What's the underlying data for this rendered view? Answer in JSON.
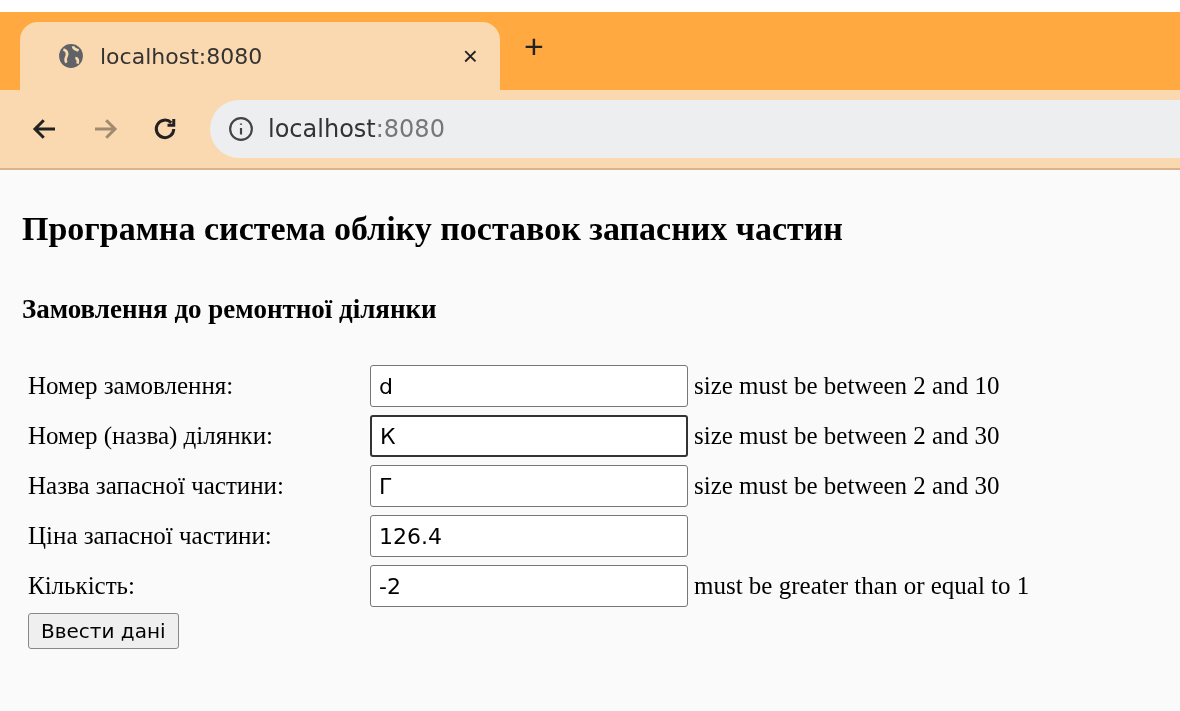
{
  "browser": {
    "tab": {
      "title": "localhost:8080",
      "close": "×",
      "new_tab": "+"
    },
    "address": {
      "host": "localhost",
      "port": ":8080"
    },
    "nav": [
      {
        "kind": "back",
        "disabled": false
      },
      {
        "kind": "forward",
        "disabled": true
      },
      {
        "kind": "reload",
        "disabled": false
      }
    ]
  },
  "page": {
    "title": "Програмна система обліку поставок запасних частин",
    "subtitle": "Замовлення до ремонтної ділянки",
    "fields": [
      {
        "label": "Номер замовлення:",
        "value": "d",
        "error": "size must be between 2 and 10",
        "focused": false
      },
      {
        "label": "Номер (назва) ділянки:",
        "value": "К",
        "error": "size must be between 2 and 30",
        "focused": true
      },
      {
        "label": "Назва запасної частини:",
        "value": "Г",
        "error": "size must be between 2 and 30",
        "focused": false
      },
      {
        "label": "Ціна запасної частини:",
        "value": "126.4",
        "focused": false
      },
      {
        "label": "Кількість:",
        "value": "-2",
        "error": "must be greater than or equal to 1",
        "focused": false
      }
    ],
    "submit": "Ввести дані"
  }
}
